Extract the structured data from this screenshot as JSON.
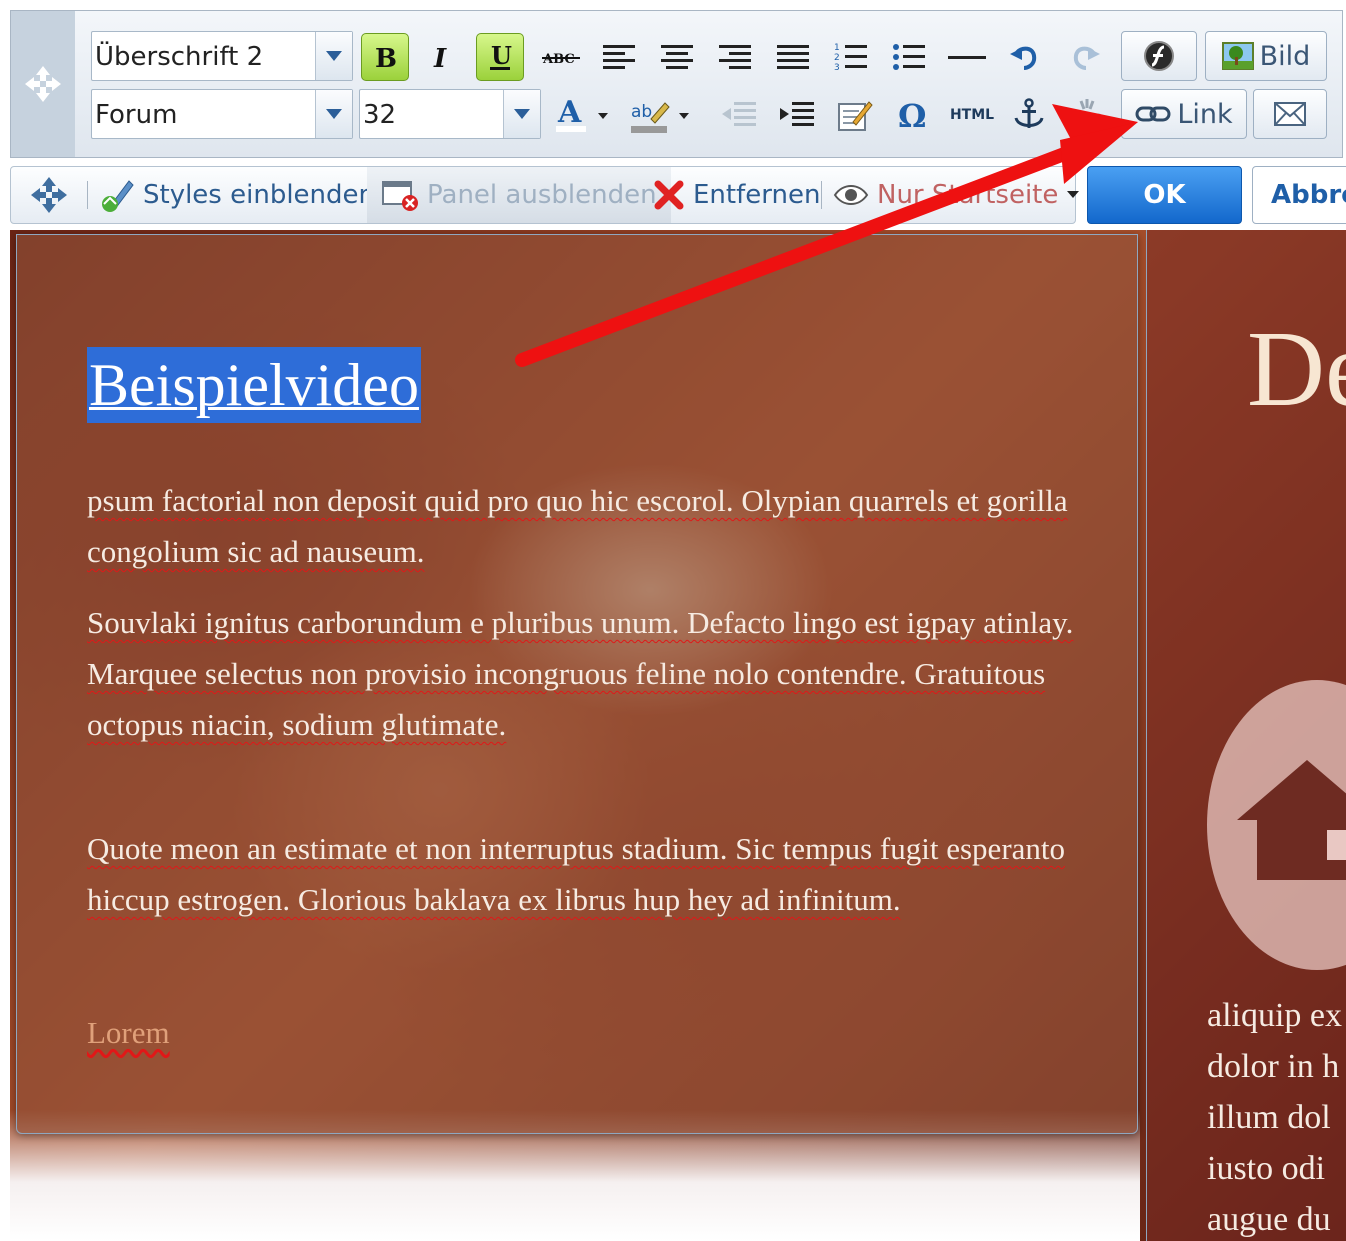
{
  "toolbar": {
    "format_value": "Überschrift 2",
    "font_value": "Forum",
    "size_value": "32",
    "html_label": "HTML",
    "image_label": "Bild",
    "link_label": "Link"
  },
  "panel_bar": {
    "styles_label": "Styles einblenden",
    "hide_panel_label": "Panel ausblenden",
    "remove_label": "Entfernen",
    "visibility_label": "Nur Startseite",
    "ok_label": "OK",
    "cancel_label": "Abbrechen"
  },
  "content": {
    "heading": "Beispielvideo",
    "paragraphs": [
      "psum factorial non deposit quid pro quo hic escorol. Olypian quarrels et gorilla congolium sic ad nauseum.",
      "Souvlaki ignitus carborundum e pluribus unum. Defacto lingo est igpay atinlay. Marquee selectus non provisio incongruous feline nolo contendre. Gratuitous octopus niacin, sodium glutimate.",
      "Quote meon an estimate et non interruptus stadium. Sic tempus fugit esperanto hiccup estrogen. Glorious baklava ex librus hup hey ad infinitum."
    ],
    "link_text": "Lorem"
  },
  "right_column": {
    "title": "De",
    "lines": [
      "aliquip ex",
      "dolor in h",
      "illum dol",
      "iusto odi",
      "augue du"
    ]
  },
  "icons": {
    "move": "move-icon",
    "bold": "bold-icon",
    "italic": "italic-icon",
    "underline": "underline-icon",
    "strike": "strikethrough-icon",
    "link": "chain-link-icon",
    "email": "envelope-icon",
    "remove": "red-x-icon",
    "visibility": "eye-icon"
  },
  "colors": {
    "selection": "#2e6dd8",
    "ok_button": "#1f74d8",
    "active_format": "#9bd13b",
    "annotation_arrow": "#ee1111"
  }
}
